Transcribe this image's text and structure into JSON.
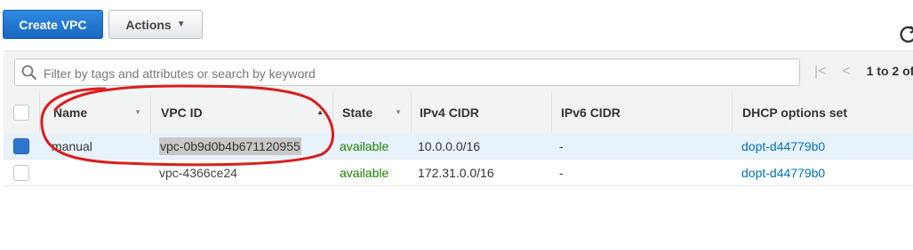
{
  "toolbar": {
    "create_label": "Create VPC",
    "actions_label": "Actions",
    "actions_caret": "▼"
  },
  "search": {
    "placeholder": "Filter by tags and attributes or search by keyword"
  },
  "pager": {
    "first_glyph": "|<",
    "prev_glyph": "<",
    "count": "1 to 2 of"
  },
  "table": {
    "columns": [
      "Name",
      "VPC ID",
      "State",
      "IPv4 CIDR",
      "IPv6 CIDR",
      "DHCP options set"
    ],
    "sort_down_glyph": "▼",
    "sort_up_glyph": "▲",
    "rows": [
      {
        "selected": true,
        "name": "manual",
        "vpc_id": "vpc-0b9d0b4b671120955",
        "state": "available",
        "ipv4": "10.0.0.0/16",
        "ipv6": "-",
        "dhcp": "dopt-d44779b0"
      },
      {
        "selected": false,
        "name": "",
        "vpc_id": "vpc-4366ce24",
        "state": "available",
        "ipv4": "172.31.0.0/16",
        "ipv6": "-",
        "dhcp": "dopt-d44779b0"
      }
    ]
  },
  "colors": {
    "primary": "#1f6fc9",
    "state_available": "#1d8102",
    "link": "#0073bb",
    "annotation": "#d81e1e"
  }
}
